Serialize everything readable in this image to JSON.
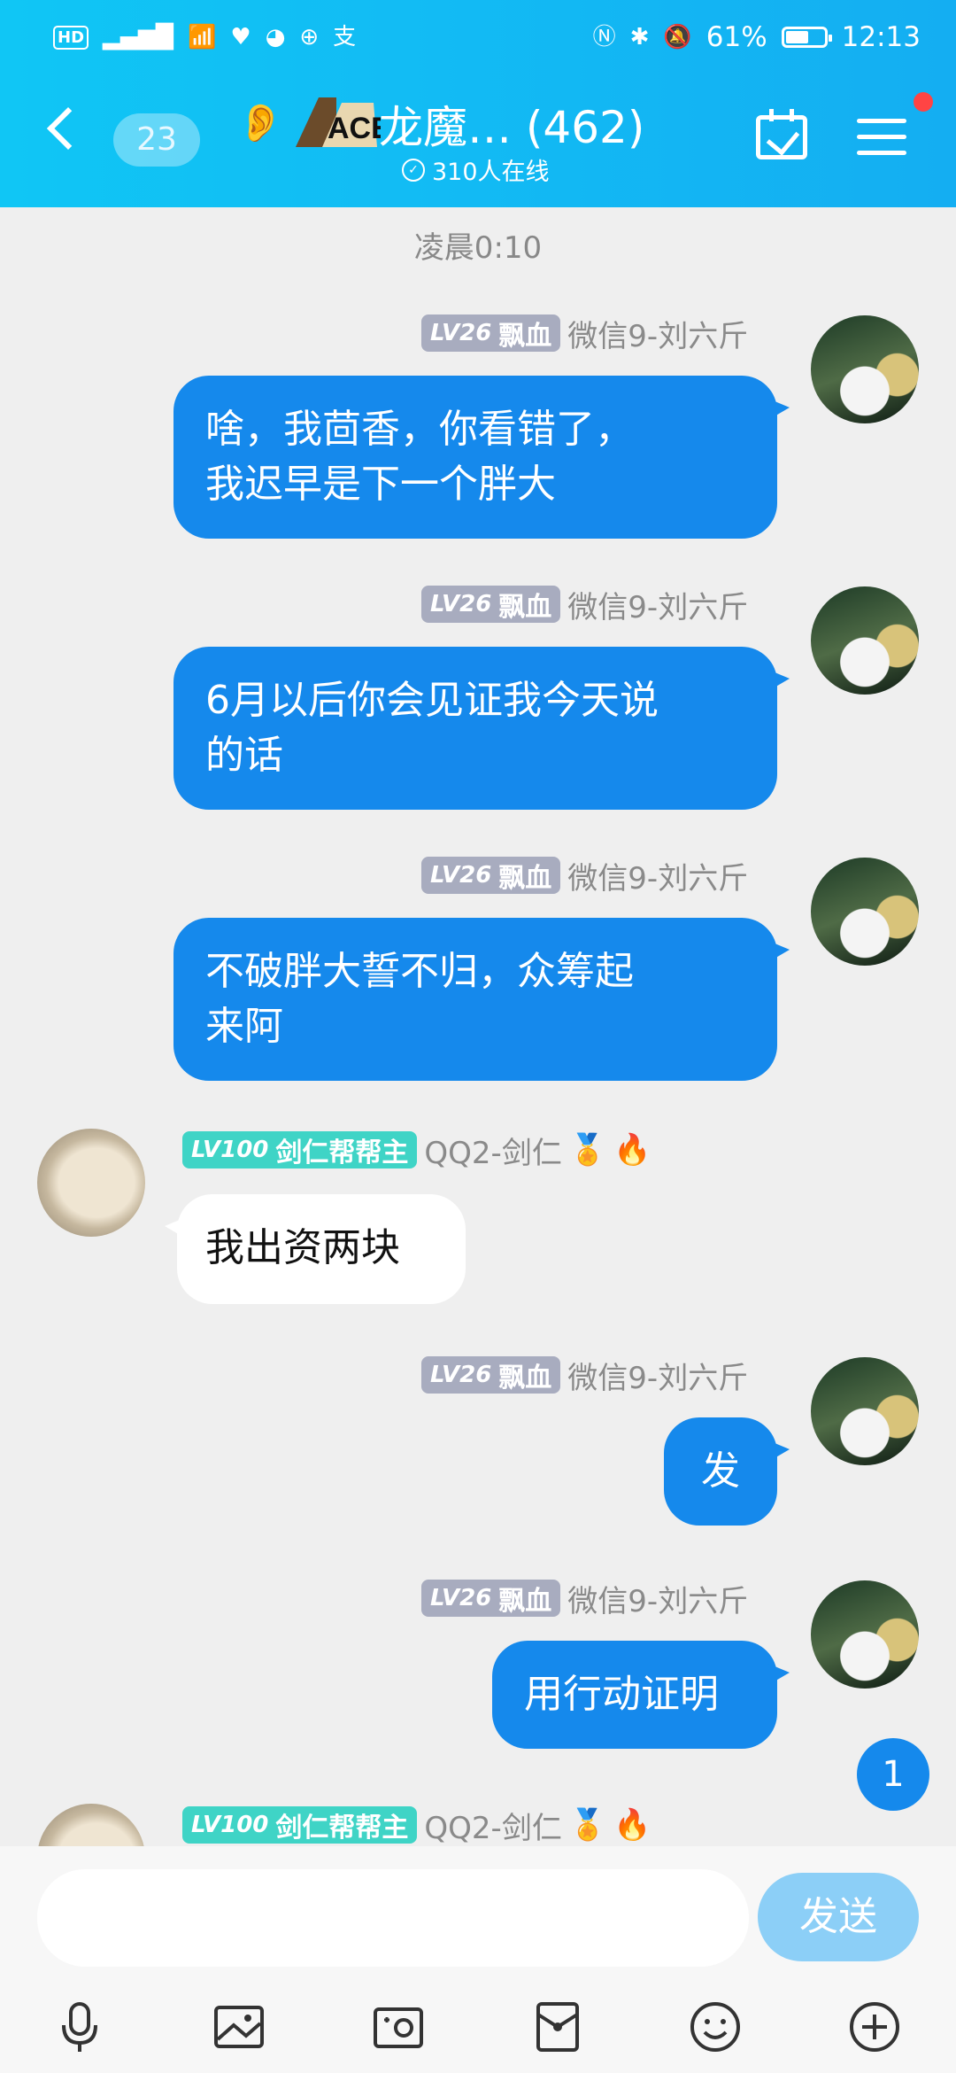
{
  "status_bar": {
    "left_icons": [
      "hd-icon",
      "signal-icon",
      "wifi-icon",
      "health-icon",
      "wechat-icon",
      "bank-icon",
      "alipay-icon"
    ],
    "battery": "61%",
    "time": "12:13"
  },
  "header": {
    "unread_count": "23",
    "group_name": "龙魔… (462)",
    "online_count": "310人在线",
    "logo_text": "ACE"
  },
  "chat": {
    "time_divider": "凌晨0:10",
    "messages": [
      {
        "side": "me",
        "level": "LV26",
        "title": "飘血",
        "name": "微信9-刘六斤",
        "text_lines": [
          "啥，我茴香，你看错了，",
          "我迟早是下一个胖大"
        ]
      },
      {
        "side": "me",
        "level": "LV26",
        "title": "飘血",
        "name": "微信9-刘六斤",
        "text_lines": [
          "6月以后你会见证我今天说",
          "的话"
        ]
      },
      {
        "side": "me",
        "level": "LV26",
        "title": "飘血",
        "name": "微信9-刘六斤",
        "text_lines": [
          "不破胖大誓不归，众筹起",
          "来阿"
        ]
      },
      {
        "side": "other",
        "level": "LV100",
        "title": "剑仁帮帮主",
        "name": "QQ2-剑仁",
        "text_lines": [
          "我出资两块"
        ]
      },
      {
        "side": "me",
        "level": "LV26",
        "title": "飘血",
        "name": "微信9-刘六斤",
        "text_lines": [
          "发"
        ]
      },
      {
        "side": "me",
        "level": "LV26",
        "title": "飘血",
        "name": "微信9-刘六斤",
        "text_lines": [
          "用行动证明"
        ]
      },
      {
        "side": "other",
        "level": "LV100",
        "title": "剑仁帮帮主",
        "name": "QQ2-剑仁",
        "text_lines": []
      }
    ],
    "new_message_badge": "1"
  },
  "input": {
    "placeholder": "",
    "send_label": "发送",
    "tools": [
      "microphone-icon",
      "image-icon",
      "camera-icon",
      "red-packet-icon",
      "emoji-icon",
      "plus-icon"
    ]
  },
  "colors": {
    "header_start": "#10c6f5",
    "header_end": "#14aef2",
    "my_bubble": "#1589ec",
    "background": "#efefef",
    "level_gray": "#a8acbf",
    "level_teal": "#3fd4c6"
  }
}
